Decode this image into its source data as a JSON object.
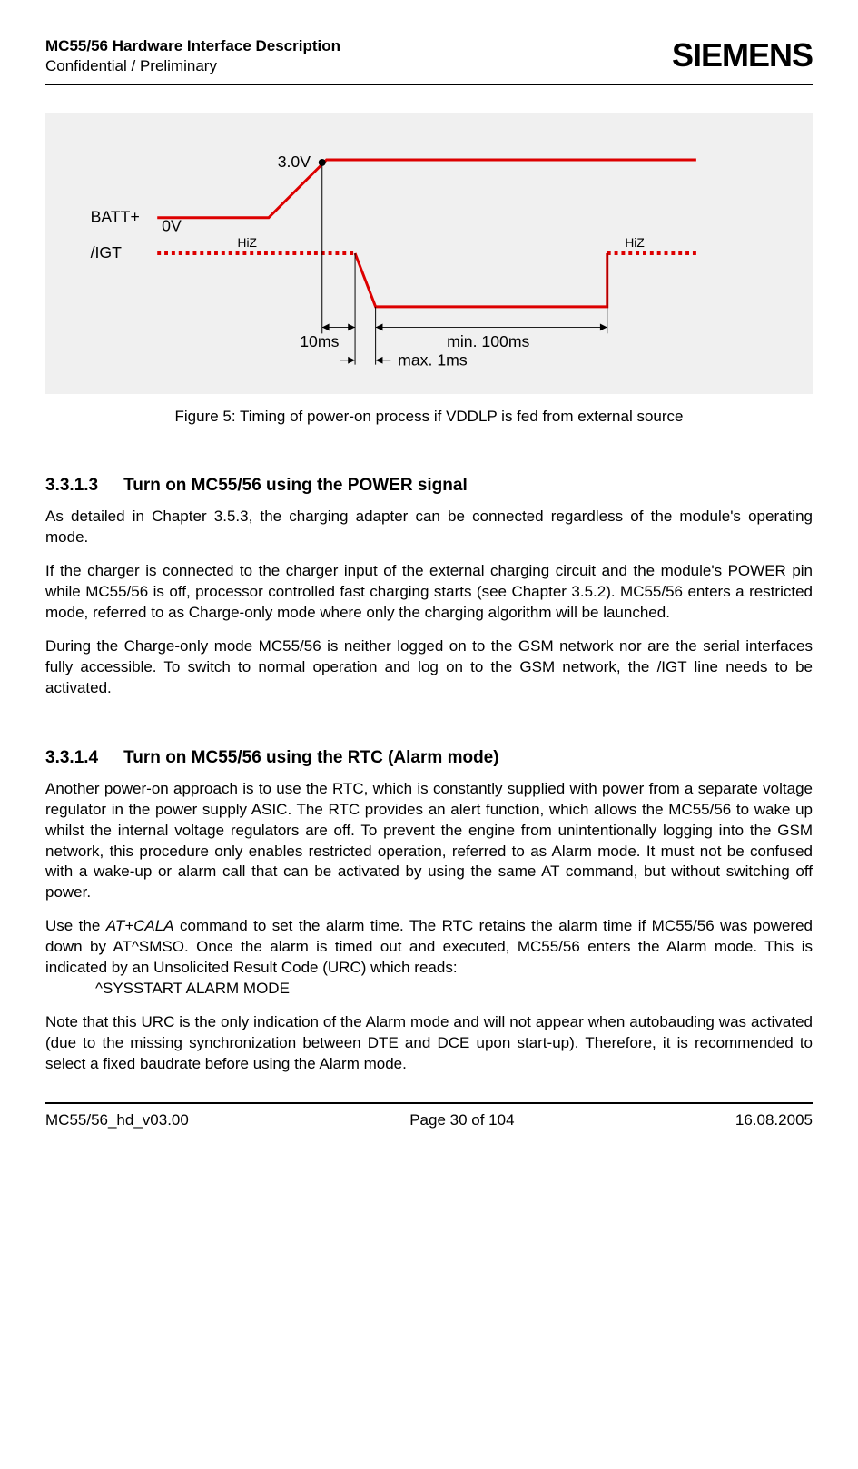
{
  "header": {
    "title": "MC55/56 Hardware Interface Description",
    "subtitle": "Confidential / Preliminary",
    "logo_text": "SIEMENS"
  },
  "chart_data": {
    "type": "timing-diagram",
    "signals": [
      {
        "name": "BATT+",
        "levels": {
          "low_label": "0V",
          "high_label": "3.0V"
        }
      },
      {
        "name": "/IGT",
        "states": [
          "HiZ",
          "low-pulse",
          "HiZ"
        ]
      }
    ],
    "annotations": {
      "delay_after_3v": "10ms",
      "fall_time": "max. 1ms",
      "low_duration": "min. 100ms",
      "hiz_left": "HiZ",
      "hiz_right": "HiZ"
    }
  },
  "figure_caption": "Figure 5: Timing of power-on process if VDDLP is fed from external source",
  "section1": {
    "number": "3.3.1.3",
    "title": "Turn on MC55/56 using the POWER signal",
    "p1": "As detailed in Chapter 3.5.3, the charging adapter can be connected regardless of the module's operating mode.",
    "p2": "If the charger is connected to the charger input of the external charging circuit and the module's POWER pin while MC55/56 is off, processor controlled fast charging starts (see Chapter 3.5.2). MC55/56 enters a restricted mode, referred to as Charge-only mode where only the charging algorithm will be launched.",
    "p3": "During the Charge-only mode MC55/56 is neither logged on to the GSM network nor are the serial interfaces fully accessible. To switch to normal operation and log on to the GSM network, the /IGT line needs to be activated."
  },
  "section2": {
    "number": "3.3.1.4",
    "title": "Turn on MC55/56 using the RTC (Alarm mode)",
    "p1": "Another power-on approach is to use the RTC, which is constantly supplied with power from a separate voltage regulator in the power supply ASIC. The RTC provides an alert function, which allows the MC55/56 to wake up whilst the internal voltage regulators are off. To prevent the engine from unintentionally logging into the GSM network, this procedure only enables restricted operation, referred to as Alarm mode. It must not be confused with a wake-up or alarm call that can be activated by using the same AT command, but without switching off power.",
    "p2_prefix": "Use the ",
    "p2_cmd": "AT+CALA",
    "p2_suffix": " command to set the alarm time. The RTC retains the alarm time if MC55/56 was powered down by AT^SMSO. Once the alarm is timed out and executed, MC55/56 enters the Alarm mode. This is indicated by an Unsolicited Result Code (URC) which reads:",
    "urc": "^SYSSTART ALARM MODE",
    "p3": "Note that this URC is the only indication of the Alarm mode and will not appear when autobauding was activated (due to the missing synchronization between DTE and DCE upon start-up). Therefore, it is recommended to select a fixed baudrate before using the Alarm mode."
  },
  "footer": {
    "left": "MC55/56_hd_v03.00",
    "center": "Page 30 of 104",
    "right": "16.08.2005"
  }
}
